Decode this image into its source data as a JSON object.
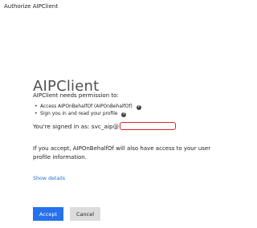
{
  "window": {
    "title": "Authorize AIPClient"
  },
  "dialog": {
    "app_name": "AIPClient",
    "needs_permission": "AIPClient needs permission to:",
    "permissions": [
      {
        "label": "Access AIPOnBehalfOf (AIPOnBehalfOf)",
        "icon": "help-icon"
      },
      {
        "label": "Sign you in and read your profile",
        "icon": "help-icon"
      }
    ],
    "signed_in_as": "You're signed in as: svc_aip@",
    "consent_text": "If you accept, AIPOnBehalfOf will also have access to your user profile information.",
    "show_details": "Show details",
    "accept_label": "Accept",
    "cancel_label": "Cancel",
    "colors": {
      "accent": "#2672ec",
      "link": "#2372c7",
      "highlight": "#d9262b"
    }
  }
}
